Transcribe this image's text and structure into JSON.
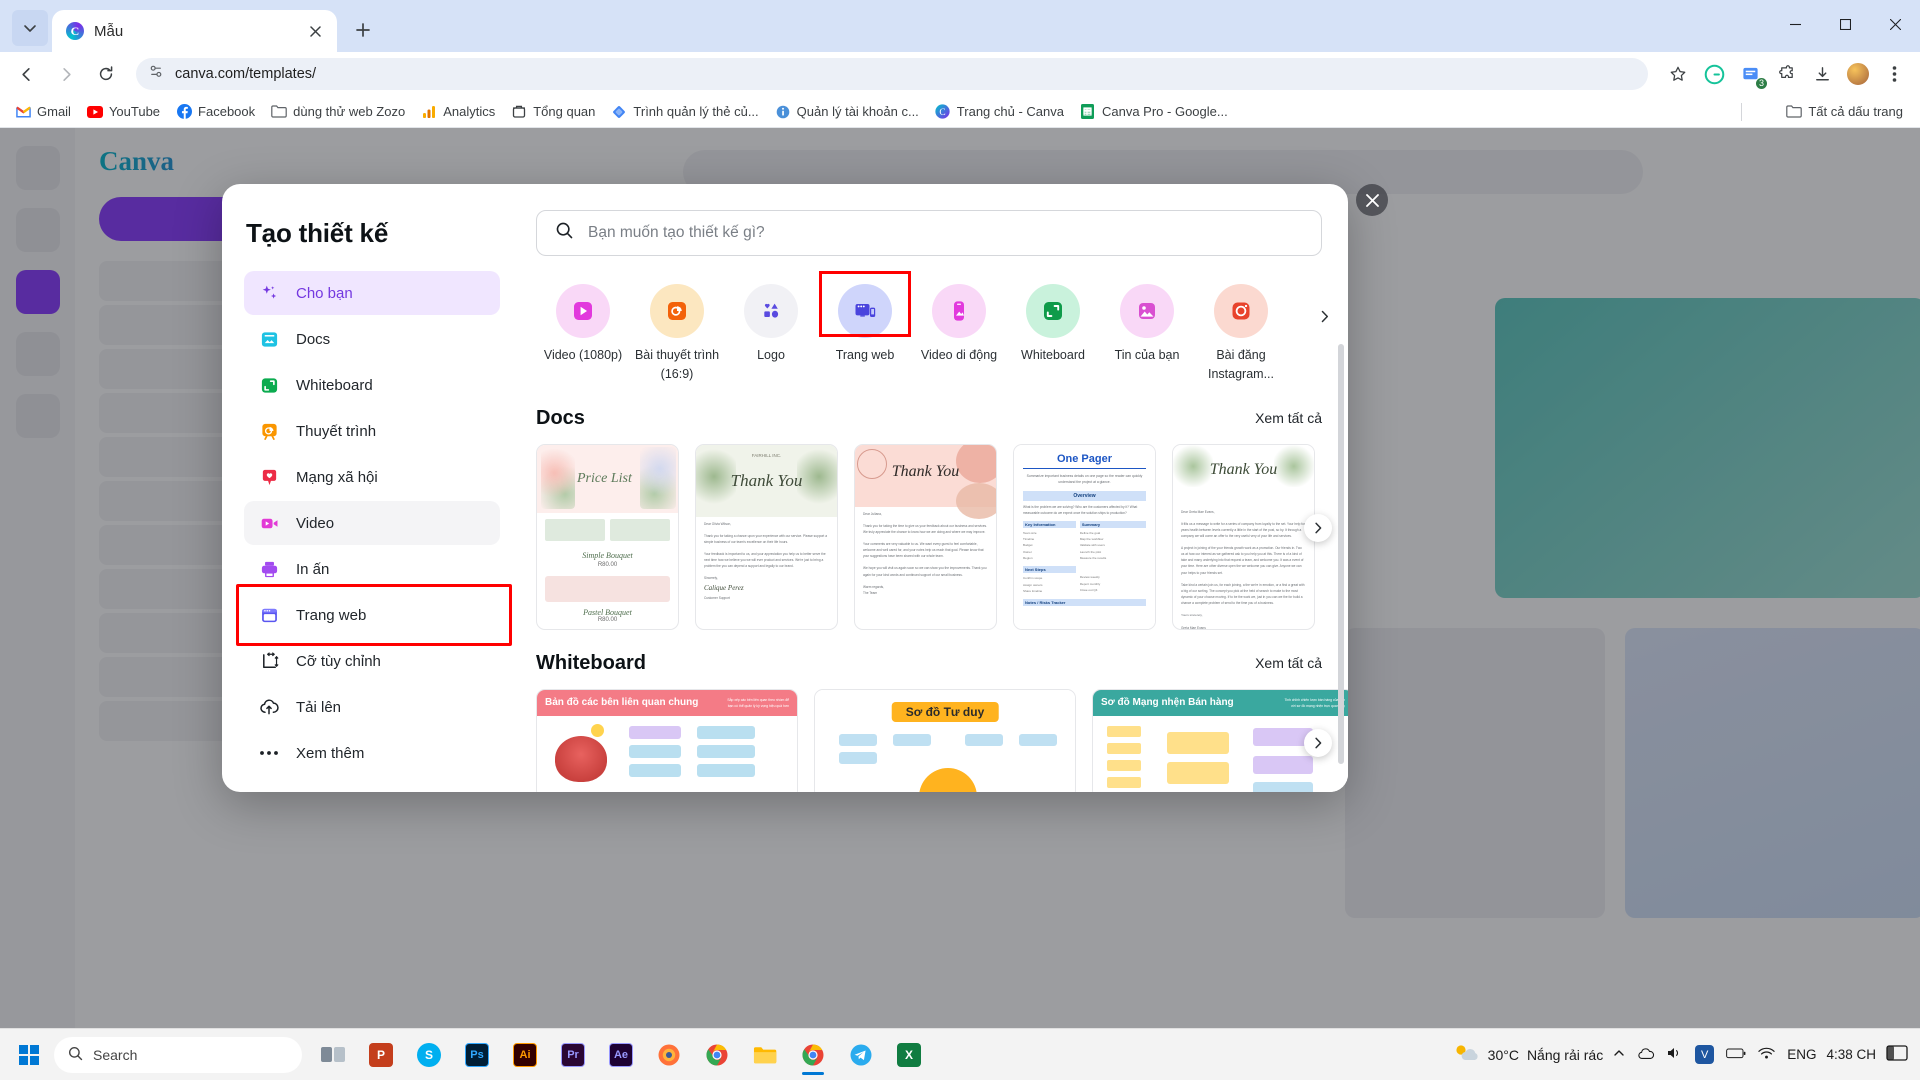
{
  "browser": {
    "tab": {
      "title": "Mẫu",
      "favicon": "canva-icon",
      "close_icon": "close-icon"
    },
    "new_tab_icon": "plus-icon",
    "tab_list_icon": "chevron-down-icon",
    "nav": {
      "back_icon": "back-arrow-icon",
      "forward_icon": "forward-arrow-icon",
      "reload_icon": "reload-icon",
      "site_info_icon": "site-settings-icon",
      "url": "canva.com/templates/",
      "bookmark_star_icon": "star-icon",
      "downloads_icon": "download-icon",
      "menu_icon": "kebab-menu-icon",
      "profile_icon": "avatar-icon",
      "extensions_icon": "puzzle-icon",
      "grammarly_icon": "grammarly-icon",
      "ext_count": "3"
    },
    "window": {
      "minimize": "–",
      "maximize": "❐",
      "close": "✕"
    },
    "bookmarks": [
      {
        "label": "Gmail",
        "icon": "gmail-icon"
      },
      {
        "label": "YouTube",
        "icon": "youtube-icon"
      },
      {
        "label": "Facebook",
        "icon": "facebook-icon"
      },
      {
        "label": "dùng thử web Zozo",
        "icon": "folder-icon"
      },
      {
        "label": "Analytics",
        "icon": "analytics-icon"
      },
      {
        "label": "Tổng quan",
        "icon": "overview-icon"
      },
      {
        "label": "Trình quản lý thẻ củ...",
        "icon": "tag-manager-icon"
      },
      {
        "label": "Quản lý tài khoản c...",
        "icon": "info-icon"
      },
      {
        "label": "Trang chủ - Canva",
        "icon": "canva-icon"
      },
      {
        "label": "Canva Pro - Google...",
        "icon": "sheets-icon"
      }
    ],
    "all_bookmarks": {
      "label": "Tất cả dấu trang",
      "icon": "folder-icon"
    }
  },
  "modal": {
    "title": "Tạo thiết kế",
    "close_icon": "close-icon",
    "search": {
      "placeholder": "Bạn muốn tạo thiết kế gì?",
      "icon": "search-icon"
    },
    "sidebar": [
      {
        "label": "Cho bạn",
        "icon": "sparkle-icon",
        "state": "selected"
      },
      {
        "label": "Docs",
        "icon": "docs-icon",
        "state": "normal"
      },
      {
        "label": "Whiteboard",
        "icon": "whiteboard-icon",
        "state": "normal"
      },
      {
        "label": "Thuyết trình",
        "icon": "presentation-icon",
        "state": "normal"
      },
      {
        "label": "Mạng xã hội",
        "icon": "social-icon",
        "state": "normal"
      },
      {
        "label": "Video",
        "icon": "video-icon",
        "state": "hover"
      },
      {
        "label": "In ấn",
        "icon": "print-icon",
        "state": "normal"
      },
      {
        "label": "Trang web",
        "icon": "website-icon",
        "state": "highlighted"
      },
      {
        "label": "Cỡ tùy chỉnh",
        "icon": "custom-size-icon",
        "state": "normal"
      },
      {
        "label": "Tải lên",
        "icon": "upload-icon",
        "state": "normal"
      },
      {
        "label": "Xem thêm",
        "icon": "more-icon",
        "state": "normal"
      }
    ],
    "categories": [
      {
        "label": "Video (1080p)",
        "icon": "video-play-icon",
        "bg": "#f9d8f7",
        "fg": "#e239dd",
        "highlighted": false
      },
      {
        "label": "Bài thuyết trình (16:9)",
        "icon": "presentation-icon",
        "bg": "#fce7c0",
        "fg": "#f3620a",
        "highlighted": false
      },
      {
        "label": "Logo",
        "icon": "shapes-icon",
        "bg": "#f1f1f5",
        "fg": "#5a4be0",
        "highlighted": false
      },
      {
        "label": "Trang web",
        "icon": "website-icon",
        "bg": "#cfd5fb",
        "fg": "#4a44dd",
        "highlighted": true
      },
      {
        "label": "Video di động",
        "icon": "mobile-video-icon",
        "bg": "#f9d8f7",
        "fg": "#e239dd",
        "highlighted": false
      },
      {
        "label": "Whiteboard",
        "icon": "whiteboard-icon",
        "bg": "#c9f2dc",
        "fg": "#0f9b4a",
        "highlighted": false
      },
      {
        "label": "Tin của bạn",
        "icon": "story-icon",
        "bg": "#f9d8f7",
        "fg": "#d94fd1",
        "highlighted": false
      },
      {
        "label": "Bài đăng Instagram...",
        "icon": "instagram-icon",
        "bg": "#fbd9d0",
        "fg": "#e8432c",
        "highlighted": false
      }
    ],
    "category_next_icon": "chevron-right-icon",
    "sections": [
      {
        "title": "Docs",
        "see_all": "Xem tất cả",
        "next_icon": "chevron-right-icon",
        "cards": [
          {
            "name": "price-list-template",
            "heading": "Price List",
            "accent": "#fdeeec"
          },
          {
            "name": "thank-you-template-1",
            "heading": "Thank You",
            "accent": "#f0f3ea"
          },
          {
            "name": "thank-you-template-2",
            "heading": "Thank You",
            "accent": "#fbdcd5"
          },
          {
            "name": "one-pager-template",
            "heading": "One Pager",
            "accent": "#ffffff"
          },
          {
            "name": "thank-you-template-3",
            "heading": "Thank You",
            "accent": "#ffffff"
          }
        ]
      },
      {
        "title": "Whiteboard",
        "see_all": "Xem tất cả",
        "next_icon": "chevron-right-icon",
        "cards": [
          {
            "name": "stakeholder-map-template",
            "heading": "Bản đồ các bên liên quan chung",
            "accent": "#f47b86"
          },
          {
            "name": "mindmap-template",
            "heading": "Sơ đồ Tư duy",
            "accent": "#ffb31f"
          },
          {
            "name": "sales-spider-map-template",
            "heading": "Sơ đồ Mạng nhện Bán hàng",
            "accent": "#3aa89f"
          }
        ]
      }
    ]
  },
  "taskbar": {
    "start_icon": "windows-icon",
    "search": {
      "label": "Search",
      "icon": "search-icon"
    },
    "apps": [
      {
        "name": "task-view",
        "icon": "taskview-icon"
      },
      {
        "name": "app-powerpoint",
        "icon": "powerpoint-icon"
      },
      {
        "name": "app-skype",
        "icon": "skype-icon"
      },
      {
        "name": "app-photoshop",
        "icon": "photoshop-icon"
      },
      {
        "name": "app-illustrator",
        "icon": "illustrator-icon"
      },
      {
        "name": "app-premiere",
        "icon": "premiere-icon"
      },
      {
        "name": "app-aftereffects",
        "icon": "aftereffects-icon"
      },
      {
        "name": "app-firefox",
        "icon": "firefox-icon"
      },
      {
        "name": "app-chrome",
        "icon": "chrome-icon"
      },
      {
        "name": "app-explorer",
        "icon": "explorer-icon"
      },
      {
        "name": "app-chrome-active",
        "icon": "chrome-icon"
      },
      {
        "name": "app-telegram",
        "icon": "telegram-icon"
      },
      {
        "name": "app-excel",
        "icon": "excel-icon"
      }
    ],
    "weather": {
      "temp": "30°C",
      "desc": "Nắng rải rác",
      "icon": "sun-cloud-icon"
    },
    "tray": [
      "chevron-up-icon",
      "onedrive-icon",
      "volume-icon",
      "unikey-icon",
      "battery-icon",
      "wifi-icon"
    ],
    "lang": "ENG",
    "time": "4:38 CH",
    "notification_icon": "notification-icon"
  }
}
